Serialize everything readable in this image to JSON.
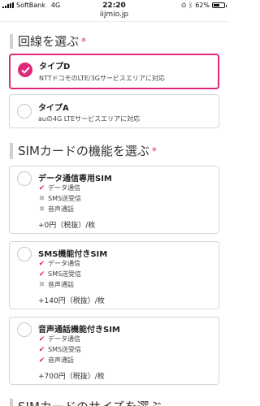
{
  "status_bar": {
    "carrier": "SoftBank",
    "network": "4G",
    "time": "22:20",
    "battery_level": 0.62,
    "battery_text": "62%"
  },
  "browser": {
    "url": "iijmio.jp"
  },
  "colors": {
    "accent": "#e0287a",
    "border": "#d6d6d6",
    "muted_mark": "#b5b5b5"
  },
  "line_section": {
    "title": "回線を選ぶ",
    "required_mark": "*",
    "options": [
      {
        "title": "タイプD",
        "description": "NTTドコモのLTE/3Gサービスエリアに対応",
        "selected": true
      },
      {
        "title": "タイプA",
        "description": "auの4G LTEサービスエリアに対応",
        "selected": false
      }
    ]
  },
  "sim_section": {
    "title": "SIMカードの機能を選ぶ",
    "required_mark": "*",
    "options": [
      {
        "title": "データ通信専用SIM",
        "features": [
          {
            "label": "データ通信",
            "available": true
          },
          {
            "label": "SMS送受信",
            "available": false
          },
          {
            "label": "音声通話",
            "available": false
          }
        ],
        "price": "+0円（税抜）/枚"
      },
      {
        "title": "SMS機能付きSIM",
        "features": [
          {
            "label": "データ通信",
            "available": true
          },
          {
            "label": "SMS送受信",
            "available": true
          },
          {
            "label": "音声通話",
            "available": false
          }
        ],
        "price": "+140円（税抜）/枚"
      },
      {
        "title": "音声通話機能付きSIM",
        "features": [
          {
            "label": "データ通信",
            "available": true
          },
          {
            "label": "SMS送受信",
            "available": true
          },
          {
            "label": "音声通話",
            "available": true
          }
        ],
        "price": "+700円（税抜）/枚"
      }
    ]
  },
  "size_section": {
    "title": "SIMカードのサイズを選ぶ"
  },
  "icons": {
    "available": "check-icon",
    "unavailable": "cross-icon",
    "selected": "checkmark-icon"
  }
}
